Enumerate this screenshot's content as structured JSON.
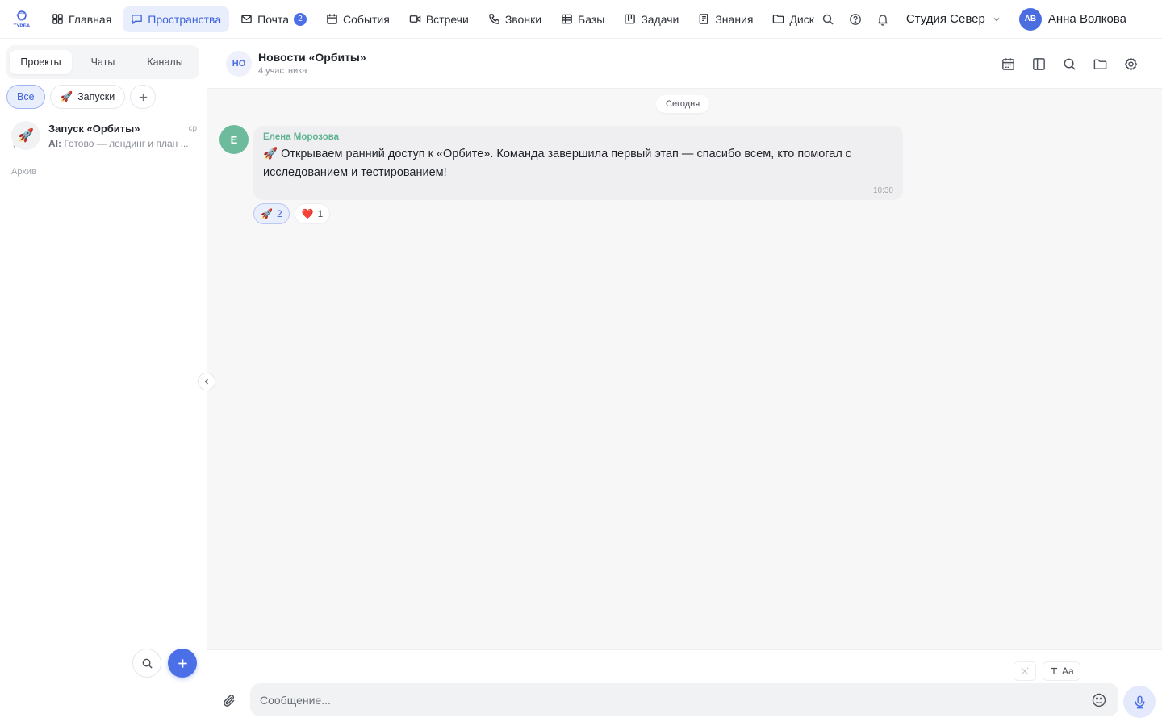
{
  "app": {
    "logo_text": "ТУРБА"
  },
  "nav": {
    "items": [
      {
        "label": "Главная",
        "icon": "grid-icon"
      },
      {
        "label": "Пространства",
        "icon": "chat-bubble-icon",
        "active": true
      },
      {
        "label": "Почта",
        "icon": "mail-icon",
        "badge": "2"
      },
      {
        "label": "События",
        "icon": "calendar-icon"
      },
      {
        "label": "Встречи",
        "icon": "video-icon"
      },
      {
        "label": "Звонки",
        "icon": "phone-icon"
      },
      {
        "label": "Базы",
        "icon": "table-icon"
      },
      {
        "label": "Задачи",
        "icon": "kanban-icon"
      },
      {
        "label": "Знания",
        "icon": "book-icon"
      },
      {
        "label": "Диск",
        "icon": "folder-icon"
      }
    ],
    "workspace": "Студия Север",
    "user": {
      "initials": "АВ",
      "name": "Анна Волкова"
    }
  },
  "sidebar": {
    "tabs": [
      "Проекты",
      "Чаты",
      "Каналы"
    ],
    "active_tab": "Проекты",
    "filters": [
      {
        "label": "Все",
        "active": true
      },
      {
        "label": "Запуски",
        "emoji": "🚀"
      }
    ],
    "chats": [
      {
        "emoji": "🚀",
        "name": "Запуск «Орбиты»",
        "time": "ср",
        "preview_author": "AI:",
        "preview": "Готово — лендинг и план ..."
      }
    ],
    "archive_label": "Архив"
  },
  "chat": {
    "initials": "НО",
    "title": "Новости «Орбиты»",
    "subtitle": "4 участника",
    "date_divider": "Сегодня",
    "messages": [
      {
        "author_initial": "Е",
        "author": "Елена Морозова",
        "text": "🚀 Открываем ранний доступ к «Орбите». Команда завершила первый этап — спасибо всем, кто помогал с исследованием и тестированием!",
        "time": "10:30",
        "reactions": [
          {
            "emoji": "🚀",
            "count": "2",
            "mine": true
          },
          {
            "emoji": "❤️",
            "count": "1",
            "mine": false
          }
        ]
      }
    ]
  },
  "composer": {
    "placeholder": "Сообщение...",
    "format_label": "Aa"
  },
  "colors": {
    "accent": "#4b6fe6",
    "accent_light": "#e9eefc",
    "author_green": "#5fb391",
    "canvas": "#f7f7f8"
  }
}
